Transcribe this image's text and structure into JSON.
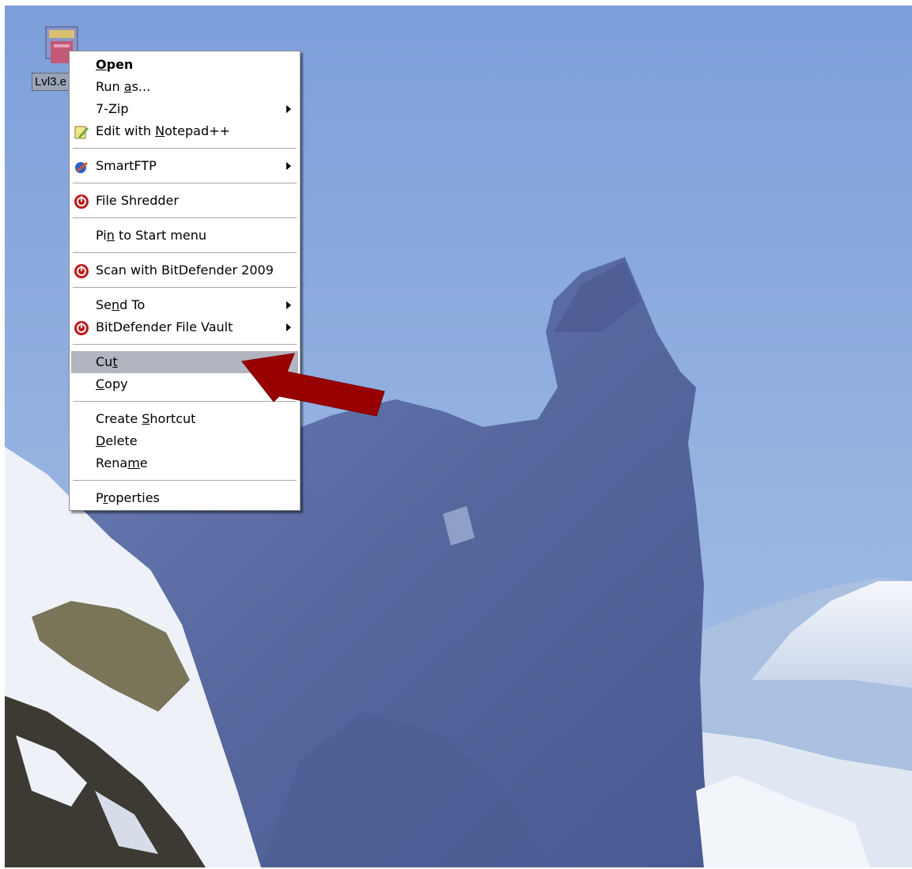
{
  "desktop": {
    "icon_label": "Lvl3.e",
    "icon_name": "batch-file-icon"
  },
  "context_menu": {
    "items": [
      {
        "pre": "",
        "acc": "O",
        "post": "pen",
        "icon": "",
        "submenu": false
      },
      {
        "pre": "Run ",
        "acc": "a",
        "post": "s...",
        "icon": "",
        "submenu": false
      },
      {
        "pre": "7-Zip",
        "acc": "",
        "post": "",
        "icon": "",
        "submenu": true
      },
      {
        "pre": "Edit with ",
        "acc": "N",
        "post": "otepad++",
        "icon": "notepad-plus-plus-icon",
        "submenu": false
      },
      {
        "pre": "SmartFTP",
        "acc": "",
        "post": "",
        "icon": "smartftp-icon",
        "submenu": true
      },
      {
        "pre": "File Shredder",
        "acc": "",
        "post": "",
        "icon": "bitdefender-icon",
        "submenu": false
      },
      {
        "pre": "Pi",
        "acc": "n",
        "post": " to Start menu",
        "icon": "",
        "submenu": false
      },
      {
        "pre": "Scan with BitDefender 2009",
        "acc": "",
        "post": "",
        "icon": "bitdefender-icon",
        "submenu": false
      },
      {
        "pre": "Se",
        "acc": "n",
        "post": "d To",
        "icon": "",
        "submenu": true
      },
      {
        "pre": "BitDefender File Vault",
        "acc": "",
        "post": "",
        "icon": "bitdefender-icon",
        "submenu": true
      },
      {
        "pre": "Cu",
        "acc": "t",
        "post": "",
        "icon": "",
        "submenu": false
      },
      {
        "pre": "",
        "acc": "C",
        "post": "opy",
        "icon": "",
        "submenu": false
      },
      {
        "pre": "Create ",
        "acc": "S",
        "post": "hortcut",
        "icon": "",
        "submenu": false
      },
      {
        "pre": "",
        "acc": "D",
        "post": "elete",
        "icon": "",
        "submenu": false
      },
      {
        "pre": "Rena",
        "acc": "m",
        "post": "e",
        "icon": "",
        "submenu": false
      },
      {
        "pre": "P",
        "acc": "r",
        "post": "operties",
        "icon": "",
        "submenu": false
      }
    ],
    "highlighted_item": "Cut"
  },
  "annotation": {
    "arrow_color": "#990000",
    "points_to": "Cut"
  },
  "colors": {
    "sky": "#7fa4dc",
    "ice": "#5e6fa6",
    "menu_highlight": "#b2b4bf"
  }
}
